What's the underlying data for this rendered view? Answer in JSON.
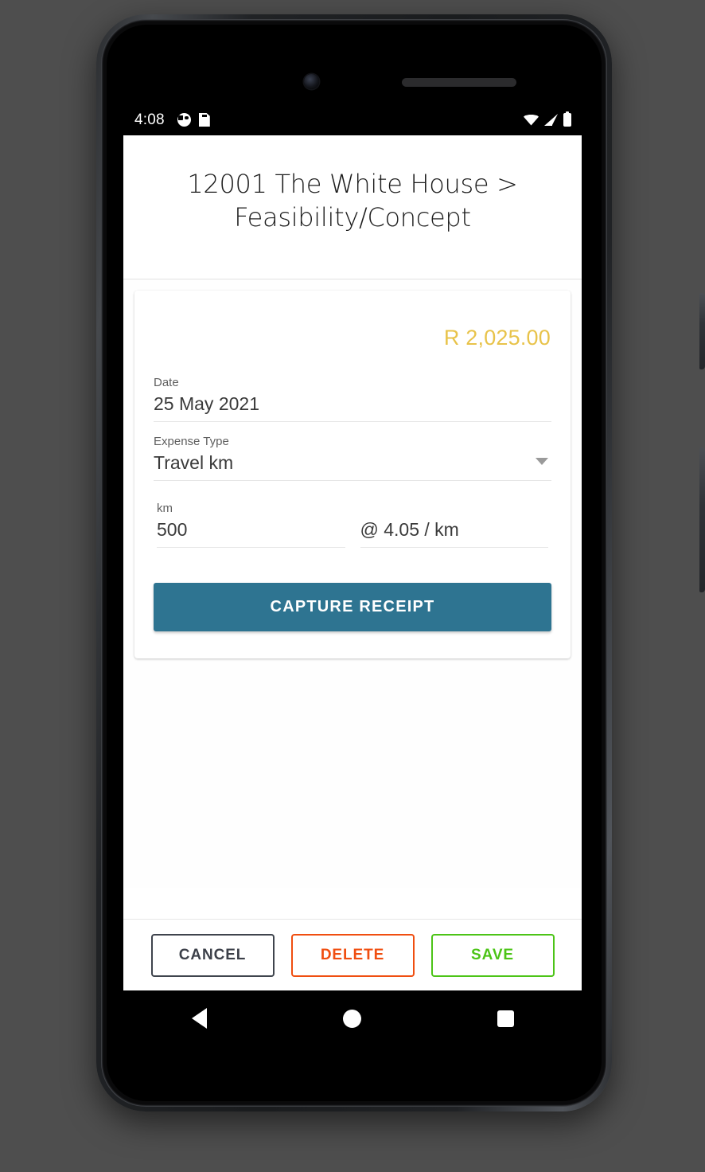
{
  "status_bar": {
    "time": "4:08",
    "left_icons": [
      "dnd-icon",
      "sd-card-icon"
    ],
    "right_icons": [
      "wifi-icon",
      "cell-signal-icon",
      "battery-icon"
    ]
  },
  "header": {
    "title": "12001 The White House > Feasibility/Concept"
  },
  "expense_card": {
    "amount": "R 2,025.00",
    "amount_color": "#e8c34a",
    "fields": {
      "date": {
        "label": "Date",
        "value": "25 May 2021"
      },
      "expense_type": {
        "label": "Expense Type",
        "value": "Travel km"
      },
      "km": {
        "label": "km",
        "value": "500"
      },
      "rate": {
        "value": "@ 4.05 / km"
      }
    },
    "capture_button": {
      "label": "CAPTURE RECEIPT",
      "color": "#2e7491"
    }
  },
  "action_bar": {
    "cancel": {
      "label": "CANCEL",
      "color": "#3c4049"
    },
    "delete": {
      "label": "DELETE",
      "color": "#f04e10"
    },
    "save": {
      "label": "SAVE",
      "color": "#4cc417"
    }
  },
  "nav_bar": {
    "back": "back-triangle-icon",
    "home": "home-circle-icon",
    "recents": "recents-square-icon"
  }
}
